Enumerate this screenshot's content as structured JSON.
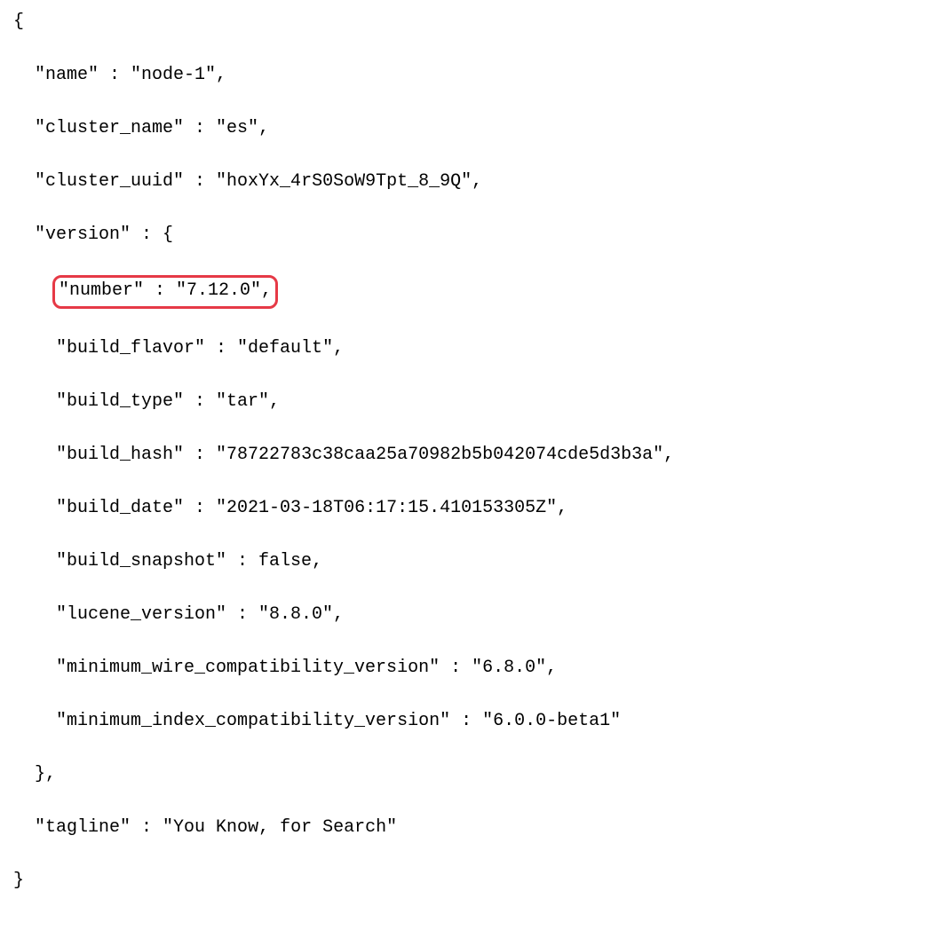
{
  "json": {
    "open_brace": "{",
    "close_brace": "}",
    "name_key": "\"name\"",
    "name_val": "\"node-1\"",
    "cluster_name_key": "\"cluster_name\"",
    "cluster_name_val": "\"es\"",
    "cluster_uuid_key": "\"cluster_uuid\"",
    "cluster_uuid_val": "\"hoxYx_4rS0SoW9Tpt_8_9Q\"",
    "version_key": "\"version\"",
    "version_open": "{",
    "version_close": "},",
    "number_key": "\"number\"",
    "number_val": "\"7.12.0\"",
    "build_flavor_key": "\"build_flavor\"",
    "build_flavor_val": "\"default\"",
    "build_type_key": "\"build_type\"",
    "build_type_val": "\"tar\"",
    "build_hash_key": "\"build_hash\"",
    "build_hash_val": "\"78722783c38caa25a70982b5b042074cde5d3b3a\"",
    "build_date_key": "\"build_date\"",
    "build_date_val": "\"2021-03-18T06:17:15.410153305Z\"",
    "build_snapshot_key": "\"build_snapshot\"",
    "build_snapshot_val": "false",
    "lucene_version_key": "\"lucene_version\"",
    "lucene_version_val": "\"8.8.0\"",
    "min_wire_key": "\"minimum_wire_compatibility_version\"",
    "min_wire_val": "\"6.8.0\"",
    "min_index_key": "\"minimum_index_compatibility_version\"",
    "min_index_val": "\"6.0.0-beta1\"",
    "tagline_key": "\"tagline\"",
    "tagline_val": "\"You Know, for Search\"",
    "colon": " : ",
    "comma": ","
  }
}
